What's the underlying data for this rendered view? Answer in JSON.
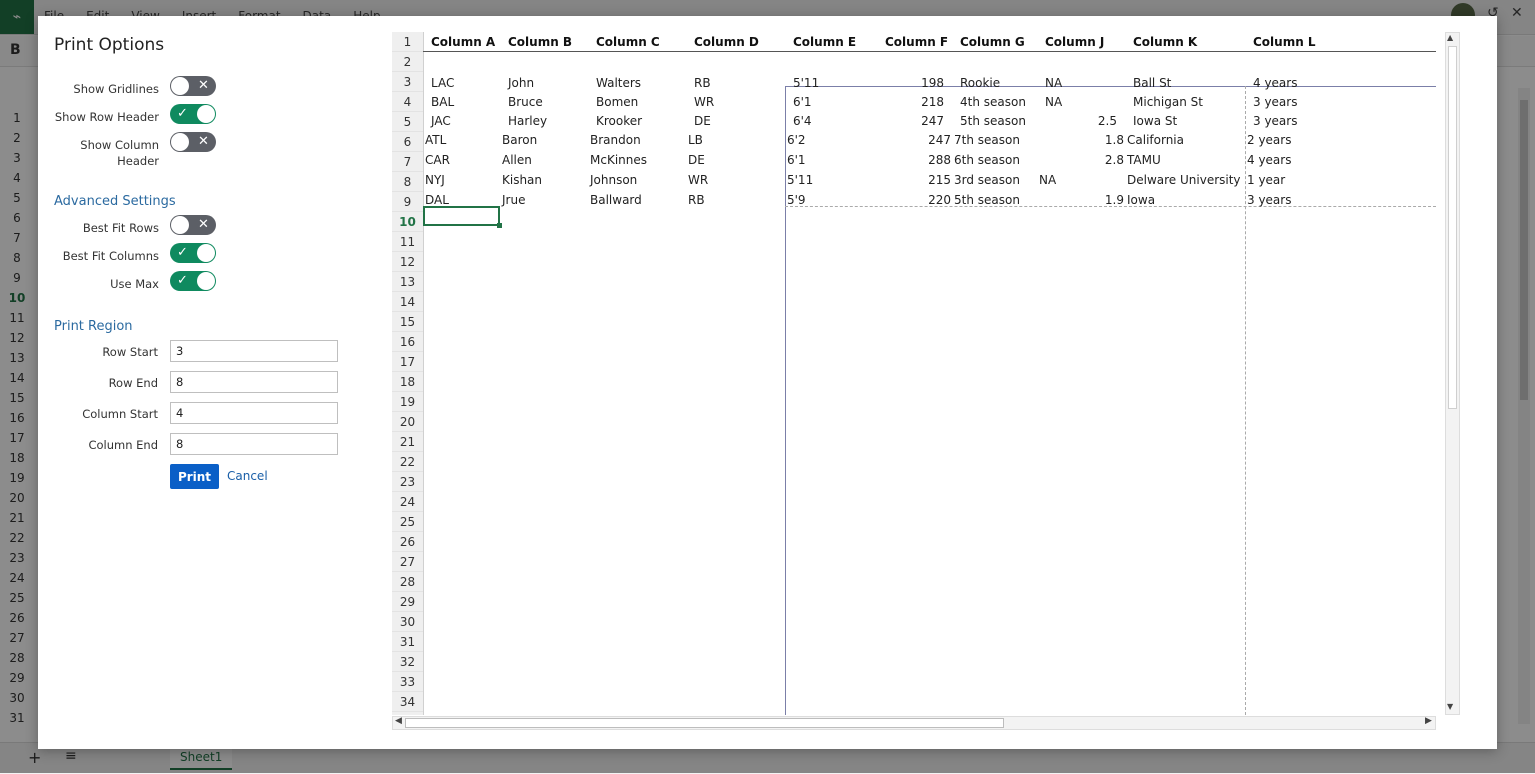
{
  "app": {
    "menu": [
      "File",
      "Edit",
      "View",
      "Insert",
      "Format",
      "Data",
      "Help"
    ],
    "bold_label": "B",
    "row_numbers": [
      "1",
      "2",
      "3",
      "4",
      "5",
      "6",
      "7",
      "8",
      "9",
      "10",
      "11",
      "12",
      "13",
      "14",
      "15",
      "16",
      "17",
      "18",
      "19",
      "20",
      "21",
      "22",
      "23",
      "24",
      "25",
      "26",
      "27",
      "28",
      "29",
      "30",
      "31"
    ],
    "active_row": "10",
    "sheet_tab": "Sheet1",
    "add_sheet_icon": "+",
    "sheet_list_icon": "≡",
    "history_icon": "↺",
    "close_icon": "✕"
  },
  "dialog": {
    "title": "Print Options",
    "options": [
      {
        "label": "Show Gridlines",
        "on": false
      },
      {
        "label": "Show Row Header",
        "on": true
      },
      {
        "label": "Show Column Header",
        "on": false
      }
    ],
    "advanced_title": "Advanced Settings",
    "advanced": [
      {
        "label": "Best Fit Rows",
        "on": false
      },
      {
        "label": "Best Fit Columns",
        "on": true
      },
      {
        "label": "Use Max",
        "on": true
      }
    ],
    "region_title": "Print Region",
    "region": {
      "row_start_label": "Row Start",
      "row_start": "3",
      "row_end_label": "Row End",
      "row_end": "8",
      "col_start_label": "Column Start",
      "col_start": "4",
      "col_end_label": "Column End",
      "col_end": "8"
    },
    "print_label": "Print",
    "cancel_label": "Cancel"
  },
  "preview": {
    "headers": [
      "Column A",
      "Column B",
      "Column C",
      "Column D",
      "Column E",
      "Column F",
      "Column G",
      "Column J",
      "Column K",
      "Column L"
    ],
    "rows": [
      [
        "LAC",
        "John",
        "Walters",
        "RB",
        "5'11",
        "198",
        "Rookie",
        "NA",
        "Ball St",
        "4 years"
      ],
      [
        "BAL",
        "Bruce",
        "Bomen",
        "WR",
        "6'1",
        "218",
        "4th season",
        "NA",
        "Michigan St",
        "3 years"
      ],
      [
        "JAC",
        "Harley",
        "Krooker",
        "DE",
        "6'4",
        "247",
        "5th season",
        "2.5",
        "Iowa St",
        "3 years"
      ],
      [
        "ATL",
        "Baron",
        "Brandon",
        "LB",
        "6'2",
        "247",
        "7th season",
        "1.8",
        "California",
        "2 years"
      ],
      [
        "CAR",
        "Allen",
        "McKinnes",
        "DE",
        "6'1",
        "288",
        "6th season",
        "2.8",
        "TAMU",
        "4 years"
      ],
      [
        "NYJ",
        "Kishan",
        "Johnson",
        "WR",
        "5'11",
        "215",
        "3rd season",
        "NA",
        "Delware University",
        "1 year"
      ],
      [
        "DAL",
        "Jrue",
        "Ballward",
        "RB",
        "5'9",
        "220",
        "5th season",
        "1.9",
        "Iowa",
        "3 years"
      ]
    ],
    "row_numbers": [
      "1",
      "2",
      "3",
      "4",
      "5",
      "6",
      "7",
      "8",
      "9",
      "10",
      "11",
      "12",
      "13",
      "14",
      "15",
      "16",
      "17",
      "18",
      "19",
      "20",
      "21",
      "22",
      "23",
      "24",
      "25",
      "26",
      "27",
      "28",
      "29",
      "30",
      "31",
      "32",
      "33",
      "34"
    ],
    "active_row": "10"
  }
}
